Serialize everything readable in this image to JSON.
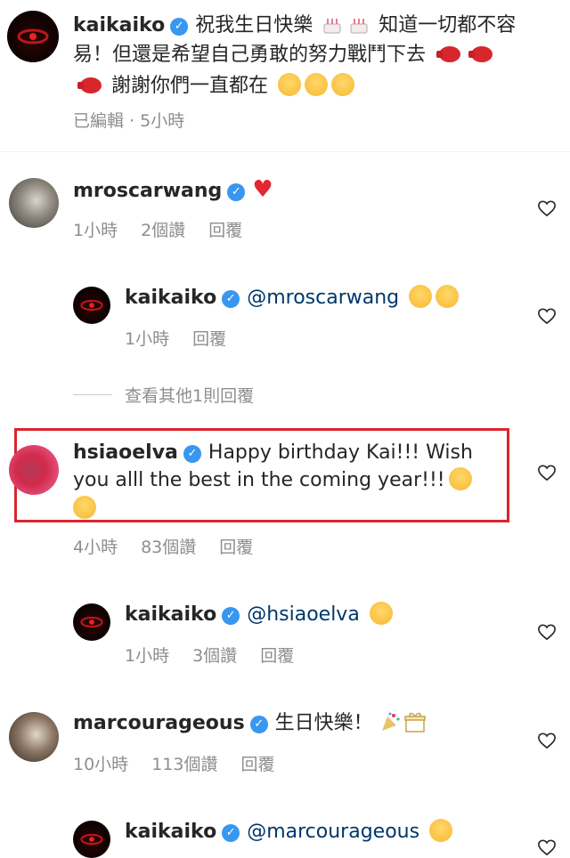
{
  "post": {
    "username": "kaikaiko",
    "caption_line1": "祝我生日快樂",
    "caption_line1b": "知道一切都不容",
    "caption_line2": "易！但還是希望自己勇敢的努力戰鬥下去",
    "caption_line3": "謝謝你們一直都在",
    "meta": "已編輯 · 5小時"
  },
  "comments": [
    {
      "username": "mroscarwang",
      "time": "1小時",
      "likes": "2個讚",
      "reply_label": "回覆"
    },
    {
      "username": "kaikaiko",
      "mention": "@mroscarwang",
      "time": "1小時",
      "reply_label": "回覆"
    },
    {
      "view_more": "查看其他1則回覆"
    },
    {
      "username": "hsiaoelva",
      "text_line1": "Happy birthday Kai!!! Wish",
      "text_line2": "you alll the best in the coming year!!!",
      "time": "4小時",
      "likes": "83個讚",
      "reply_label": "回覆"
    },
    {
      "username": "kaikaiko",
      "mention": "@hsiaoelva",
      "time": "1小時",
      "likes": "3個讚",
      "reply_label": "回覆"
    },
    {
      "username": "marcourageous",
      "text": "生日快樂！",
      "time": "10小時",
      "likes": "113個讚",
      "reply_label": "回覆"
    },
    {
      "username": "kaikaiko",
      "mention": "@marcourageous"
    }
  ],
  "colors": {
    "verified": "#3897f0",
    "mention": "#00376b",
    "meta": "#8e8e8e",
    "highlight_box": "#d8262d"
  }
}
